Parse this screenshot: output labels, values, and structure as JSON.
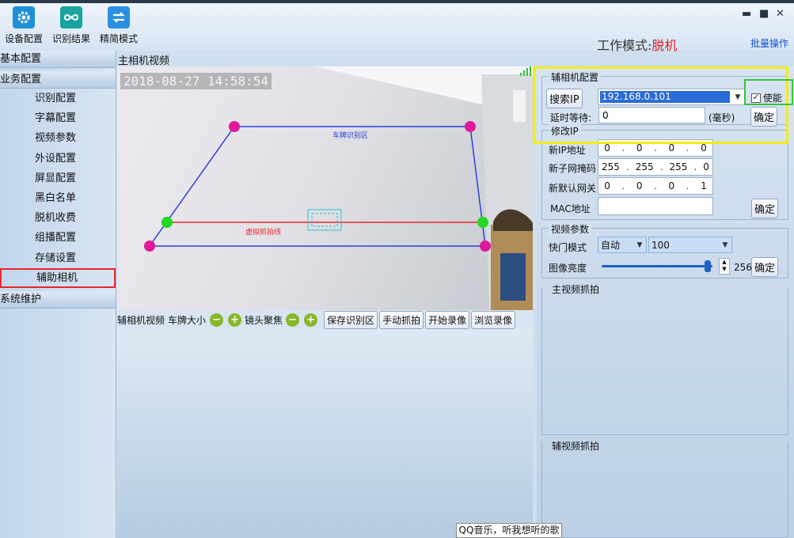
{
  "toolbar": {
    "device_config": "设备配置",
    "recognition_result": "识别结果",
    "simple_mode": "精简模式",
    "work_mode_label": "工作模式:",
    "work_mode_value": "脱机",
    "batch_operation": "批量操作"
  },
  "nav": {
    "basic_config": "基本配置",
    "business_config": "业务配置",
    "items": [
      "识别配置",
      "字幕配置",
      "视频参数",
      "外设配置",
      "屏显配置",
      "黑白名单",
      "脱机收费",
      "组播配置",
      "存储设置",
      "辅助相机"
    ],
    "system_maintenance": "系统维护"
  },
  "main": {
    "title": "主相机视频",
    "timestamp": "2018-08-27 14:58:54",
    "zone_label": "车牌识别区",
    "line_label": "虚拟抓拍线"
  },
  "controls": {
    "aux_video": "辅相机视频",
    "plate_size": "车牌大小",
    "lens_focus": "镜头聚焦",
    "minus": "−",
    "plus": "+",
    "save_zone": "保存识别区",
    "manual_capture": "手动抓拍",
    "start_record": "开始录像",
    "browse_record": "浏览录像"
  },
  "aux_config": {
    "legend": "辅相机配置",
    "search_ip": "搜索IP",
    "ip_value": "192.168.0.101",
    "enable_label": "使能",
    "enable_checked": true,
    "delay_label": "延时等待:",
    "delay_value": "0",
    "ms_label": "(毫秒)",
    "confirm": "确定"
  },
  "modify_ip": {
    "legend": "修改IP",
    "new_ip_label": "新IP地址",
    "new_ip": [
      "0",
      "0",
      "0",
      "0"
    ],
    "subnet_label": "新子网掩码",
    "subnet": [
      "255",
      "255",
      "255",
      "0"
    ],
    "gateway_label": "新默认网关",
    "gateway": [
      "0",
      "0",
      "0",
      "1"
    ],
    "mac_label": "MAC地址",
    "mac_value": "",
    "confirm": "确定"
  },
  "video_params": {
    "legend": "视频参数",
    "shutter_label": "快门模式",
    "shutter_mode": "自动",
    "shutter_value": "100",
    "brightness_label": "图像亮度",
    "brightness_value": "256",
    "confirm": "确定"
  },
  "captures": {
    "main_capture": "主视频抓拍",
    "aux_capture": "辅视频抓拍"
  },
  "tooltip": "QQ音乐，听我想听的歌",
  "colors": {
    "zone_line": "#2b3fd8",
    "capture_line": "#e8262c",
    "corner_handle": "#e0189a",
    "line_handle": "#22d822",
    "highlight_yellow": "#f2ec1c",
    "highlight_green": "#35c43a",
    "selected_nav_border": "#e8262c"
  }
}
